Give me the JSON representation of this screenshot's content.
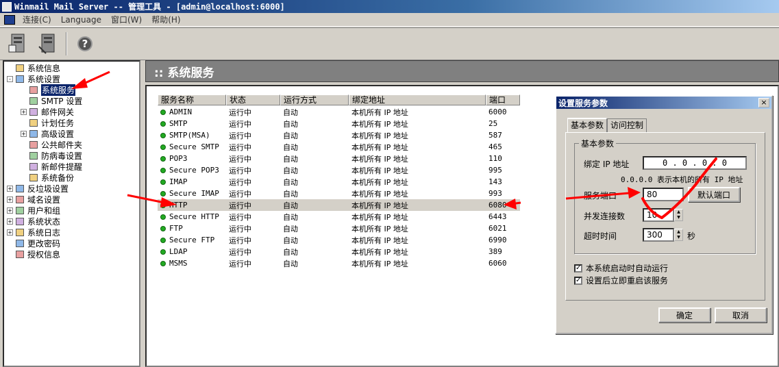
{
  "window": {
    "title": "Winmail Mail Server -- 管理工具 - [admin@localhost:6000]"
  },
  "menu": [
    "连接(C)",
    "Language",
    "窗口(W)",
    "帮助(H)"
  ],
  "toolbar": {
    "buttons": [
      "connect-icon",
      "disconnect-icon",
      "help-icon"
    ],
    "help_glyph": "?"
  },
  "tree": {
    "items": [
      {
        "label": "系统信息",
        "level": 0,
        "exp": "",
        "icon": "info-icon"
      },
      {
        "label": "系统设置",
        "level": 0,
        "exp": "-",
        "icon": "settings-icon"
      },
      {
        "label": "系统服务",
        "level": 1,
        "exp": "",
        "icon": "service-icon",
        "selected": true
      },
      {
        "label": "SMTP 设置",
        "level": 1,
        "exp": "",
        "icon": "smtp-icon"
      },
      {
        "label": "邮件网关",
        "level": 1,
        "exp": "+",
        "icon": "gateway-icon"
      },
      {
        "label": "计划任务",
        "level": 1,
        "exp": "",
        "icon": "task-icon"
      },
      {
        "label": "高级设置",
        "level": 1,
        "exp": "+",
        "icon": "advanced-icon"
      },
      {
        "label": "公共邮件夹",
        "level": 1,
        "exp": "",
        "icon": "folder-icon"
      },
      {
        "label": "防病毒设置",
        "level": 1,
        "exp": "",
        "icon": "antivirus-icon"
      },
      {
        "label": "新邮件提醒",
        "level": 1,
        "exp": "",
        "icon": "notify-icon"
      },
      {
        "label": "系统备份",
        "level": 1,
        "exp": "",
        "icon": "backup-icon"
      },
      {
        "label": "反垃圾设置",
        "level": 0,
        "exp": "+",
        "icon": "antispam-icon"
      },
      {
        "label": "域名设置",
        "level": 0,
        "exp": "+",
        "icon": "domain-icon"
      },
      {
        "label": "用户和组",
        "level": 0,
        "exp": "+",
        "icon": "users-icon"
      },
      {
        "label": "系统状态",
        "level": 0,
        "exp": "+",
        "icon": "status-icon"
      },
      {
        "label": "系统日志",
        "level": 0,
        "exp": "+",
        "icon": "log-icon"
      },
      {
        "label": "更改密码",
        "level": 0,
        "exp": "",
        "icon": "password-icon"
      },
      {
        "label": "授权信息",
        "level": 0,
        "exp": "",
        "icon": "license-icon"
      }
    ]
  },
  "panel": {
    "title": ":: 系统服务"
  },
  "services": {
    "columns": [
      "服务名称",
      "状态",
      "运行方式",
      "绑定地址",
      "端口"
    ],
    "rows": [
      [
        "ADMIN",
        "运行中",
        "自动",
        "本机所有 IP 地址",
        "6000"
      ],
      [
        "SMTP",
        "运行中",
        "自动",
        "本机所有 IP 地址",
        "25"
      ],
      [
        "SMTP(MSA)",
        "运行中",
        "自动",
        "本机所有 IP 地址",
        "587"
      ],
      [
        "Secure SMTP",
        "运行中",
        "自动",
        "本机所有 IP 地址",
        "465"
      ],
      [
        "POP3",
        "运行中",
        "自动",
        "本机所有 IP 地址",
        "110"
      ],
      [
        "Secure POP3",
        "运行中",
        "自动",
        "本机所有 IP 地址",
        "995"
      ],
      [
        "IMAP",
        "运行中",
        "自动",
        "本机所有 IP 地址",
        "143"
      ],
      [
        "Secure IMAP",
        "运行中",
        "自动",
        "本机所有 IP 地址",
        "993"
      ],
      [
        "HTTP",
        "运行中",
        "自动",
        "本机所有 IP 地址",
        "6080"
      ],
      [
        "Secure HTTP",
        "运行中",
        "自动",
        "本机所有 IP 地址",
        "6443"
      ],
      [
        "FTP",
        "运行中",
        "自动",
        "本机所有 IP 地址",
        "6021"
      ],
      [
        "Secure FTP",
        "运行中",
        "自动",
        "本机所有 IP 地址",
        "6990"
      ],
      [
        "LDAP",
        "运行中",
        "自动",
        "本机所有 IP 地址",
        "389"
      ],
      [
        "MSMS",
        "运行中",
        "自动",
        "本机所有 IP 地址",
        "6060"
      ]
    ],
    "selected_row": 8
  },
  "dialog": {
    "title": "设置服务参数",
    "close": "×",
    "tabs": [
      "基本参数",
      "访问控制"
    ],
    "group_title": "基本参数",
    "bind_ip_label": "绑定 IP 地址",
    "bind_ip_value": "0 . 0 . 0 . 0",
    "bind_ip_hint": "0.0.0.0 表示本机的所有 IP 地址",
    "port_label": "服务端口",
    "port_value": "80",
    "default_port_button": "默认端口",
    "concurrent_label": "并发连接数",
    "concurrent_value": "10",
    "timeout_label": "超时时间",
    "timeout_value": "300",
    "timeout_unit": "秒",
    "auto_start_label": "本系统启动时自动运行",
    "auto_start_checked": "✓",
    "restart_label": "设置后立即重启该服务",
    "restart_checked": "✓",
    "ok_button": "确定",
    "cancel_button": "取消"
  },
  "colors": {
    "annotation": "#ff0000",
    "title_bar": "#0a246a",
    "running_dot": "#22aa22"
  }
}
